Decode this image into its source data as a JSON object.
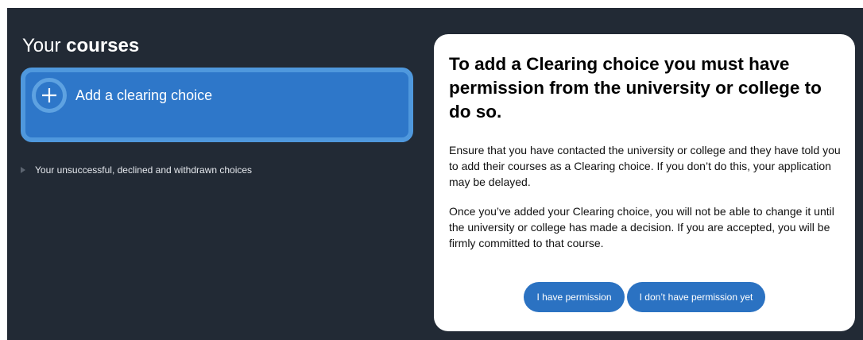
{
  "courses": {
    "heading_prefix": "Your ",
    "heading_bold": "courses",
    "add_choice_label": "Add a clearing choice",
    "unsuccessful_label": "Your unsuccessful, declined and withdrawn choices"
  },
  "modal": {
    "title": "To add a Clearing choice you must have permission from the university or college to do so.",
    "paragraph_1": "Ensure that you have contacted the university or college and they have told you to add their courses as a Clearing choice. If you don’t do this, your application may be delayed.",
    "paragraph_2": "Once you’ve added your Clearing choice, you will not be able to change it until the university or college has made a decision. If you are accepted, you will be firmly committed to that course.",
    "btn_permission": "I have permission",
    "btn_no_permission": "I don’t have permission yet"
  },
  "icons": {
    "add": "plus-circle-icon",
    "disclosure": "triangle-right-icon"
  },
  "colors": {
    "background": "#222a35",
    "accent_blue": "#2e77c9",
    "button_blue": "#2b72c2",
    "modal_bg": "#ffffff"
  }
}
